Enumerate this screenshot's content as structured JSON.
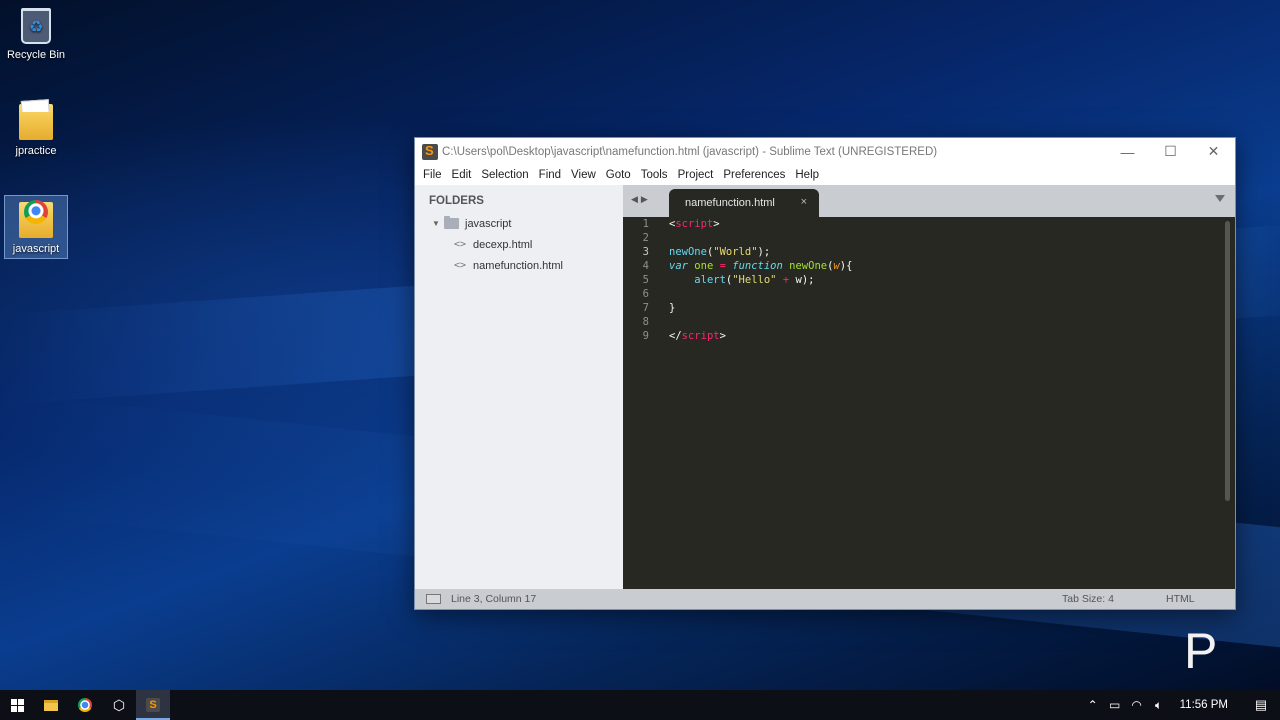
{
  "desktop": {
    "icons": [
      {
        "label": "Recycle Bin"
      },
      {
        "label": "jpractice"
      },
      {
        "label": "javascript"
      }
    ]
  },
  "window": {
    "title": "C:\\Users\\pol\\Desktop\\javascript\\namefunction.html (javascript) - Sublime Text (UNREGISTERED)",
    "minimize": "—",
    "maximize": "☐",
    "close": "✕"
  },
  "menu": {
    "file": "File",
    "edit": "Edit",
    "selection": "Selection",
    "find": "Find",
    "view": "View",
    "goto": "Goto",
    "tools": "Tools",
    "project": "Project",
    "preferences": "Preferences",
    "help": "Help"
  },
  "sidebar": {
    "heading": "FOLDERS",
    "folder": "javascript",
    "files": [
      "decexp.html",
      "namefunction.html"
    ]
  },
  "tab": {
    "name": "namefunction.html",
    "close": "×"
  },
  "code": {
    "line_numbers": [
      "1",
      "2",
      "3",
      "4",
      "5",
      "6",
      "7",
      "8",
      "9"
    ],
    "current_line": 3,
    "open_tag": "script",
    "call_name": "newOne",
    "call_arg": "\"World\"",
    "kw_var": "var",
    "var_name": "one",
    "kw_function": "function",
    "fn_name": "newOne",
    "param": "w",
    "alert_name": "alert",
    "alert_str": "\"Hello\"",
    "alert_var": "w",
    "close_brace": "}",
    "close_tag": "script"
  },
  "status": {
    "position": "Line 3, Column 17",
    "tab_size": "Tab Size: 4",
    "syntax": "HTML"
  },
  "watermark": "P",
  "taskbar": {
    "clock": "11:56 PM",
    "tray_icons": [
      "chevron-up-icon",
      "battery-icon",
      "wifi-icon",
      "volume-icon"
    ]
  }
}
